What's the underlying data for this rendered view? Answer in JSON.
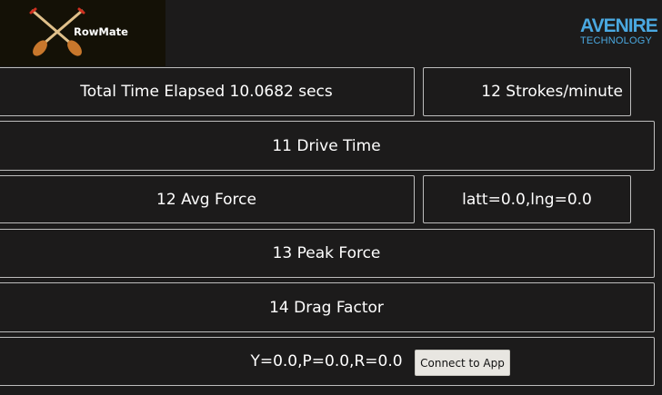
{
  "logo": {
    "text": "RowMate",
    "icon": "crossed-oars-icon"
  },
  "brand": {
    "main": "AVENIRE",
    "sub": "TECHNOLOGY"
  },
  "nav_icon": "navigation-arrow-icon",
  "panels": {
    "time_elapsed": "Total Time Elapsed 10.0682 secs",
    "stroke_rate": "12 Strokes/minute",
    "drive_time": "11 Drive Time",
    "avg_force": "12 Avg Force",
    "location": "latt=0.0,lng=0.0",
    "peak_force": "13 Peak Force",
    "drag_factor": "14 Drag Factor",
    "orientation": "Y=0.0,P=0.0,R=0.0"
  },
  "connect_button": "Connect to App",
  "colors": {
    "background": "#1c1b1b",
    "border": "#bdbdbd",
    "brand": "#4aa8e0",
    "oar": "#c8772c"
  }
}
